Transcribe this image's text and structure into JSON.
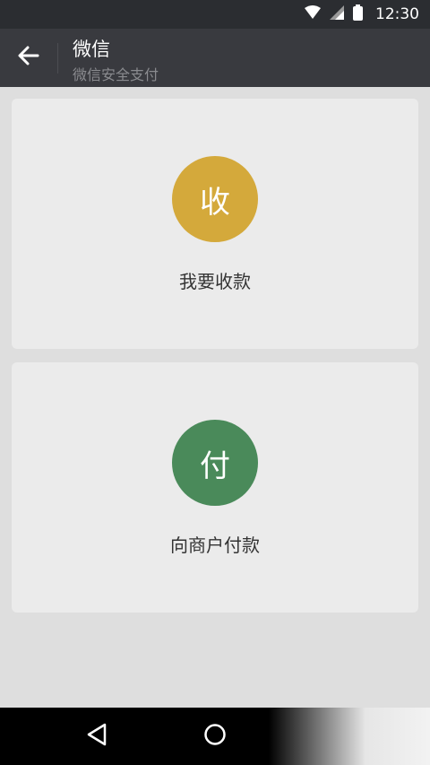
{
  "status_bar": {
    "time": "12:30",
    "icons": [
      "wifi-icon",
      "signal-icon",
      "battery-icon"
    ]
  },
  "app_bar": {
    "back_icon": "arrow-left-icon",
    "title": "微信",
    "subtitle": "微信安全支付"
  },
  "cards": [
    {
      "circle_text": "收",
      "circle_color": "#d4a93b",
      "label": "我要收款"
    },
    {
      "circle_text": "付",
      "circle_color": "#4a8a5a",
      "label": "向商户付款"
    }
  ],
  "nav_bar": {
    "icons": [
      "back-triangle-icon",
      "home-circle-icon"
    ]
  },
  "colors": {
    "status_bar_bg": "#2b2d31",
    "app_bar_bg": "#393a3f",
    "page_bg": "#dedede",
    "card_bg": "#ebebeb"
  }
}
